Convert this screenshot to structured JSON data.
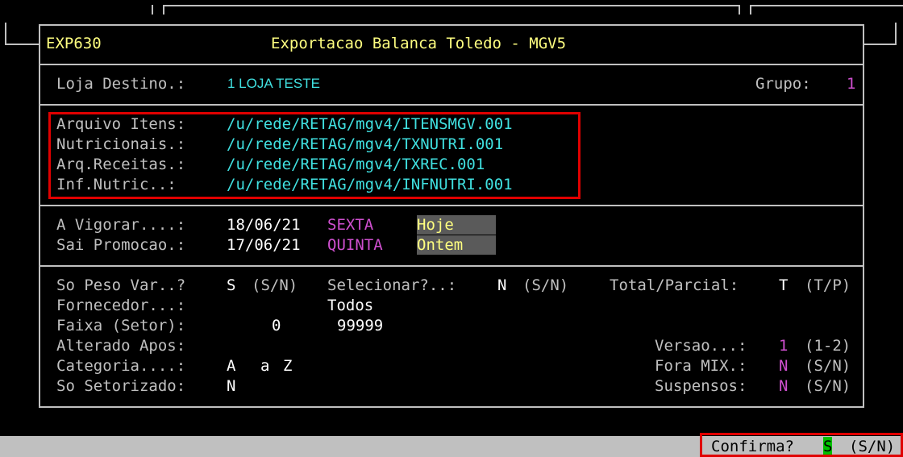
{
  "header": {
    "program_code": "EXP630",
    "title": "Exportacao Balanca Toledo - MGV5"
  },
  "store": {
    "label": "Loja Destino.:",
    "value": "1 LOJA TESTE",
    "group_label": "Grupo:",
    "group_value": "1"
  },
  "files": {
    "items_label": "Arquivo Itens:",
    "items_path": "/u/rede/RETAG/mgv4/ITENSMGV.001",
    "nutri_label": "Nutricionais.:",
    "nutri_path": "/u/rede/RETAG/mgv4/TXNUTRI.001",
    "recipes_label": "Arq.Receitas.:",
    "recipes_path": "/u/rede/RETAG/mgv4/TXREC.001",
    "infnutri_label": "Inf.Nutric..:",
    "infnutri_path": "/u/rede/RETAG/mgv4/INFNUTRI.001"
  },
  "dates": {
    "effective_label": "A Vigorar....:",
    "effective_date": "18/06/21",
    "effective_weekday": "SEXTA",
    "effective_relative": "Hoje",
    "promo_end_label": "Sai Promocao.:",
    "promo_end_date": "17/06/21",
    "promo_end_weekday": "QUINTA",
    "promo_end_relative": "Ontem"
  },
  "options": {
    "weight_only_label": "So Peso Var..?",
    "weight_only_value": "S",
    "weight_only_hint": "(S/N)",
    "select_label": "Selecionar?..:",
    "select_value": "N",
    "select_hint": "(S/N)",
    "total_label": "Total/Parcial:",
    "total_value": "T",
    "total_hint": "(T/P)",
    "supplier_label": "Fornecedor...:",
    "supplier_value": "Todos",
    "range_label": "Faixa (Setor):",
    "range_from": "0",
    "range_to": "99999",
    "changed_after_label": "Alterado Apos:",
    "version_label": "Versao...:",
    "version_value": "1",
    "version_hint": "(1-2)",
    "category_label": "Categoria....:",
    "category_from": "A",
    "category_sep": "a",
    "category_to": "Z",
    "off_mix_label": "Fora MIX.:",
    "off_mix_value": "N",
    "off_mix_hint": "(S/N)",
    "sectorized_label": "So Setorizado:",
    "sectorized_value": "N",
    "suspended_label": "Suspensos:",
    "suspended_value": "N",
    "suspended_hint": "(S/N)"
  },
  "status_bar": {
    "confirm_label": "Confirma?",
    "confirm_value": "S",
    "confirm_hint": "(S/N)"
  }
}
